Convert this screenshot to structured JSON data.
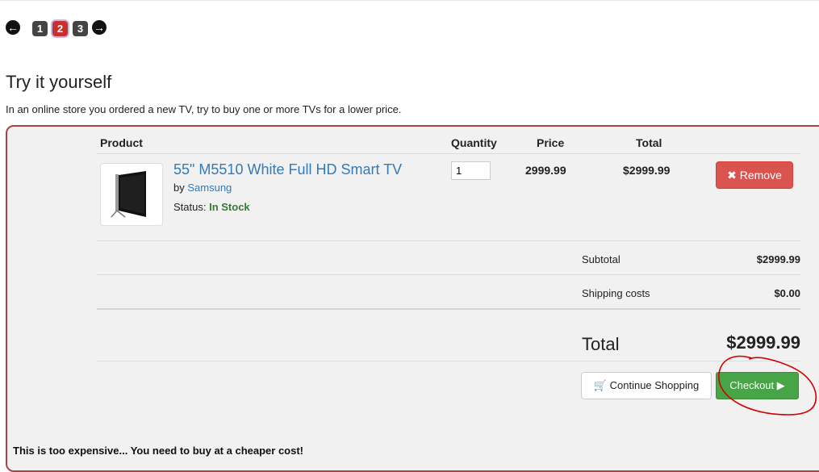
{
  "pagination": {
    "prev_icon": "arrow-left-icon",
    "pages": [
      "1",
      "2",
      "3"
    ],
    "current_page": "2",
    "next_icon": "arrow-right-icon"
  },
  "title": "Try it yourself",
  "description": "In an online store you ordered a new TV, try to buy one or more TVs for a lower price.",
  "cart": {
    "headers": {
      "product": "Product",
      "quantity": "Quantity",
      "price": "Price",
      "total": "Total"
    },
    "item": {
      "name": "55\" M5510 White Full HD Smart TV",
      "by_prefix": "by",
      "brand": "Samsung",
      "status_label": "Status:",
      "status": "In Stock",
      "quantity": "1",
      "price": "2999.99",
      "total": "$2999.99",
      "remove_label": "Remove",
      "remove_icon": "times-icon"
    },
    "summary": {
      "subtotal_label": "Subtotal",
      "subtotal_value": "$2999.99",
      "shipping_label": "Shipping costs",
      "shipping_value": "$0.00",
      "total_label": "Total",
      "total_value": "$2999.99"
    },
    "continue_label": "Continue Shopping",
    "continue_icon": "shopping-cart-icon",
    "checkout_label": "Checkout",
    "checkout_icon": "play-icon"
  },
  "message": "This is too expensive... You need to buy at a cheaper cost!",
  "colors": {
    "accent_red": "#d9534f",
    "accent_green": "#47a447",
    "link_blue": "#337ab7",
    "panel_border": "#a94442",
    "annotation_red": "#d40000"
  }
}
